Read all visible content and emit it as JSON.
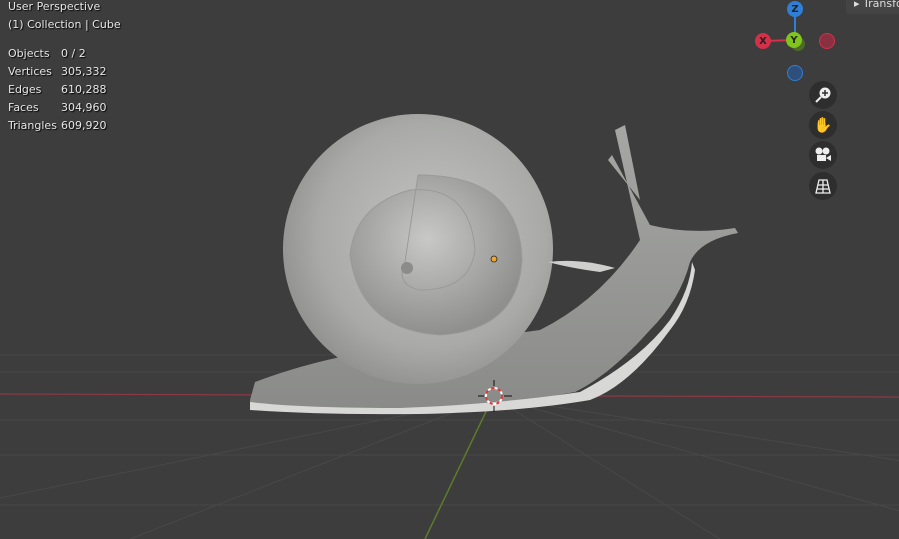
{
  "viewport": {
    "view_name": "User Perspective",
    "collection_label": "(1) Collection | Cube"
  },
  "stats": [
    {
      "label": "Objects",
      "value": "0 / 2"
    },
    {
      "label": "Vertices",
      "value": "305,332"
    },
    {
      "label": "Edges",
      "value": "610,288"
    },
    {
      "label": "Faces",
      "value": "304,960"
    },
    {
      "label": "Triangles",
      "value": "609,920"
    }
  ],
  "sidebar_tab": {
    "label": "Transform"
  },
  "gizmo": {
    "x": "X",
    "y": "Y",
    "z": "Z",
    "colors": {
      "x": "#d4304a",
      "y": "#7fc51c",
      "z": "#2f7fd6"
    }
  },
  "nav_buttons": [
    {
      "icon": "zoom-icon"
    },
    {
      "icon": "hand-pan-icon"
    },
    {
      "icon": "camera-icon"
    },
    {
      "icon": "grid-ortho-icon"
    }
  ]
}
